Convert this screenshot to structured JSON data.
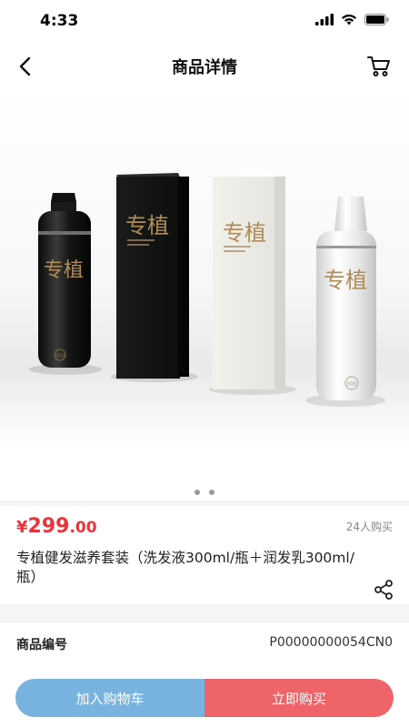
{
  "status_bar": {
    "time": "4:33"
  },
  "nav": {
    "title": "商品详情",
    "back_icon": "chevron-left-icon",
    "cart_icon": "cart-icon"
  },
  "gallery": {
    "dot_count": 2,
    "active_index": 0
  },
  "product": {
    "price_currency": "¥",
    "price_integer": "299",
    "price_decimal": ".00",
    "sold": "24人购买",
    "title": "专植健发滋养套装（洗发液300ml/瓶＋润发乳300ml/瓶）",
    "brand_mark": "专植",
    "size_label": "300"
  },
  "info": {
    "label": "商品编号",
    "value": "P00000000054CN0"
  },
  "actions": {
    "add_to_cart": "加入购物车",
    "buy_now": "立即购买"
  },
  "colors": {
    "price": "#e8343a",
    "add_to_cart_bg": "#78b3df",
    "buy_now_bg": "#ef6468"
  }
}
